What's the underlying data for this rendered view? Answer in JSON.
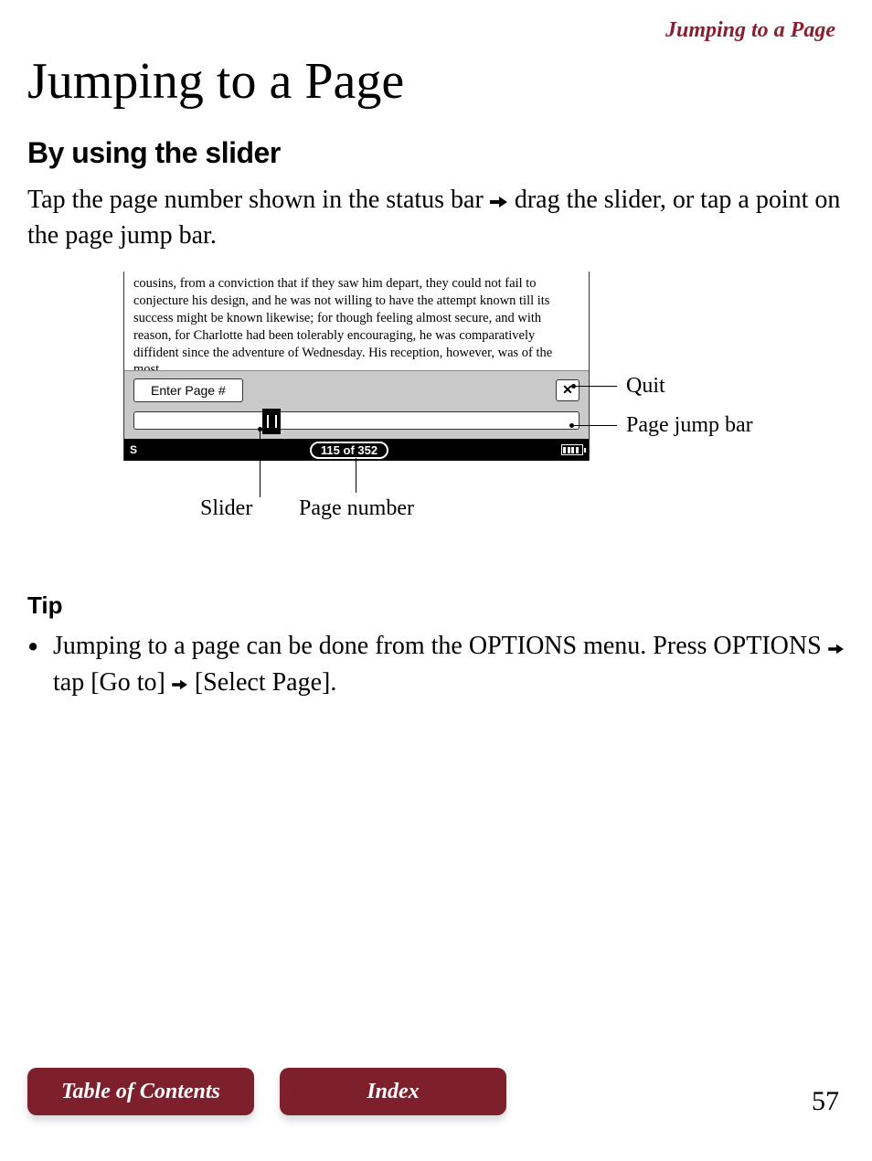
{
  "header": {
    "running": "Jumping to a Page",
    "title": "Jumping to a Page"
  },
  "section": {
    "subheading": "By using the slider",
    "body_pre": "Tap the page number shown in the status bar",
    "body_post": "drag the slider, or tap a point on the page jump bar."
  },
  "diagram": {
    "snippet": "cousins, from a conviction that if they saw him depart, they could not fail to conjecture his design, and he was not willing to have the attempt known till its success might be known likewise; for though feeling almost secure, and with reason, for Charlotte had been tolerably encouraging, he was comparatively diffident since the adventure of Wednesday. His reception, however, was of the most",
    "enter_label": "Enter Page #",
    "close_glyph": "✕",
    "status_left": "S",
    "page_of": "115 of 352",
    "callouts": {
      "quit": "Quit",
      "page_jump_bar": "Page jump bar",
      "slider": "Slider",
      "page_number": "Page number"
    }
  },
  "tip": {
    "heading": "Tip",
    "item_pre": "Jumping to a page can be done from the OPTIONS menu. Press OPTIONS",
    "item_mid": "tap [Go to]",
    "item_post": "[Select Page]."
  },
  "footer": {
    "toc": "Table of Contents",
    "index": "Index",
    "page_number": "57"
  }
}
